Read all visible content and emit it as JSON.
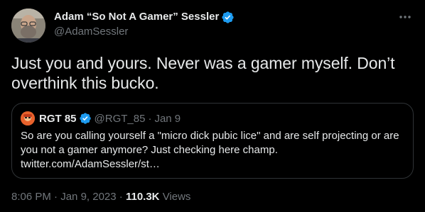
{
  "author": {
    "display_name": "Adam “So Not A Gamer” Sessler",
    "handle": "@AdamSessler",
    "verified_color": "#1d9bf0"
  },
  "tweet": {
    "text": "Just you and yours. Never was a gamer myself. Don’t overthink this bucko.",
    "time": "8:06 PM",
    "sep1": "·",
    "date": "Jan 9, 2023",
    "sep2": "·",
    "views_count": "110.3K",
    "views_label": "Views"
  },
  "quote": {
    "display_name": "RGT 85",
    "handle": "@RGT_85",
    "sep": "·",
    "date": "Jan 9",
    "text": "So are you calling yourself a \"micro dick pubic lice\" and are self projecting or are you not a gamer anymore? Just checking here champ. twitter.com/AdamSessler/st…"
  },
  "icons": {
    "more": "more-horizontal-icon",
    "verified": "verified-badge-icon"
  },
  "colors": {
    "background": "#000000",
    "text_primary": "#e7e9ea",
    "text_secondary": "#71767b",
    "border": "#2f3336",
    "accent": "#1d9bf0"
  }
}
